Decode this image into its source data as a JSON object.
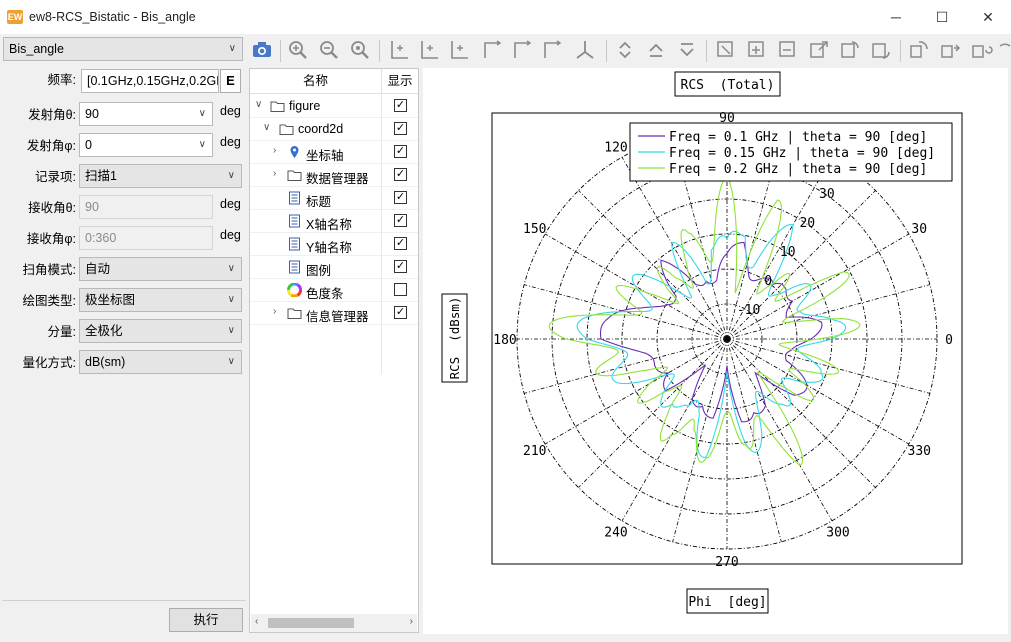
{
  "window": {
    "title": "ew8-RCS_Bistatic - Bis_angle",
    "logo_text": "EW",
    "minimize_glyph": "─",
    "maximize_glyph": "☐",
    "close_glyph": "✕"
  },
  "left_panel": {
    "view_select": "Bis_angle",
    "freq": {
      "label": "频率:",
      "value": "[0.1GHz,0.15GHz,0.2GHz]",
      "button": "E"
    },
    "tx_theta": {
      "label": "发射角θ:",
      "value": "90",
      "unit": "deg"
    },
    "tx_phi": {
      "label": "发射角φ:",
      "value": "0",
      "unit": "deg"
    },
    "record": {
      "label": "记录项:",
      "value": "扫描1"
    },
    "rx_theta": {
      "label": "接收角θ:",
      "value": "90",
      "unit": "deg"
    },
    "rx_phi": {
      "label": "接收角φ:",
      "value": "0:360",
      "unit": "deg"
    },
    "scan_mode": {
      "label": "扫角模式:",
      "value": "自动"
    },
    "plot_type": {
      "label": "绘图类型:",
      "value": "极坐标图"
    },
    "component": {
      "label": "分量:",
      "value": "全极化"
    },
    "quant": {
      "label": "量化方式:",
      "value": "dB(sm)"
    },
    "run_button": "执行"
  },
  "tree": {
    "col_name": "名称",
    "col_show": "显示",
    "rows": [
      {
        "label": "figure",
        "expander": "∨",
        "checked": true
      },
      {
        "label": "coord2d",
        "expander": "∨",
        "checked": true
      },
      {
        "label": "坐标轴",
        "expander": "›",
        "checked": true
      },
      {
        "label": "数据管理器",
        "expander": "›",
        "checked": true
      },
      {
        "label": "标题",
        "expander": "",
        "checked": true
      },
      {
        "label": "X轴名称",
        "expander": "",
        "checked": true
      },
      {
        "label": "Y轴名称",
        "expander": "",
        "checked": true
      },
      {
        "label": "图例",
        "expander": "",
        "checked": true
      },
      {
        "label": "色度条",
        "expander": "",
        "checked": false
      },
      {
        "label": "信息管理器",
        "expander": "›",
        "checked": true
      }
    ],
    "scroll_left": "‹",
    "scroll_right": "›"
  },
  "toolbar": {
    "icons": [
      "camera-icon",
      "zoom-in-icon",
      "zoom-out-icon",
      "zoom-reset-icon",
      "add-x-axis-icon",
      "add-z-axis-icon",
      "add-y-axis-icon",
      "axis-yx-icon",
      "axis-xz-icon",
      "axis-zy-icon",
      "axes-3d-icon",
      "move-up-down-icon",
      "move-up-icon",
      "move-down-icon",
      "fit-icon",
      "expand-icon",
      "collapse-icon",
      "export-icon",
      "rotate-icon",
      "rotate-alt-icon",
      "refresh-view-icon",
      "redo-view-icon",
      "reset-view-icon",
      "more-icon"
    ]
  },
  "plot": {
    "title": "RCS  (Total)",
    "ylabel": "RCS  (dBsm)",
    "xlabel": "Phi  [deg]",
    "colors": {
      "series1": "#6a2bb8",
      "series2": "#35d8e8",
      "series3": "#8fe33a"
    }
  },
  "chart_data": {
    "type": "polar",
    "title": "RCS  (Total)",
    "xlabel": "Phi  [deg]",
    "ylabel": "RCS  (dBsm)",
    "angle_ticks": [
      "0",
      "30",
      "60",
      "90",
      "120",
      "150",
      "180",
      "210",
      "240",
      "270",
      "300",
      "330"
    ],
    "radial_ticks": [
      "-10",
      "0",
      "10",
      "20",
      "30"
    ],
    "radial_range": [
      -20,
      40
    ],
    "legend_position": "top-right",
    "grid": true,
    "series": [
      {
        "name": "Freq = 0.1 GHz | theta = 90 [deg]",
        "phi": [
          0,
          10,
          20,
          30,
          40,
          50,
          60,
          70,
          80,
          90,
          100,
          110,
          120,
          130,
          140,
          150,
          160,
          170,
          180,
          190,
          200,
          210,
          220,
          230,
          240,
          250,
          260,
          270,
          280,
          290,
          300,
          310,
          320,
          330,
          340,
          350
        ],
        "rcs": [
          4,
          3,
          -2,
          6,
          2,
          -4,
          0,
          3,
          8,
          0,
          -3,
          2,
          -2,
          5,
          -1,
          4,
          6,
          10,
          16,
          8,
          2,
          -5,
          3,
          -6,
          0,
          -4,
          3,
          -8,
          4,
          -2,
          2,
          -3,
          5,
          2,
          -2,
          3
        ]
      },
      {
        "name": "Freq = 0.15 GHz | theta = 90 [deg]",
        "phi": [
          0,
          10,
          20,
          30,
          40,
          50,
          60,
          70,
          80,
          90,
          100,
          110,
          120,
          130,
          140,
          150,
          160,
          170,
          180,
          190,
          200,
          210,
          220,
          230,
          240,
          250,
          260,
          270,
          280,
          290,
          300,
          310,
          320,
          330,
          340,
          350
        ],
        "rcs": [
          10,
          6,
          9,
          4,
          -2,
          6,
          12,
          3,
          14,
          2,
          10,
          -2,
          6,
          2,
          4,
          7,
          10,
          14,
          20,
          14,
          8,
          4,
          6,
          -2,
          8,
          2,
          10,
          -4,
          6,
          8,
          3,
          -2,
          4,
          8,
          2,
          6
        ]
      },
      {
        "name": "Freq = 0.2 GHz | theta = 90 [deg]",
        "phi": [
          0,
          10,
          20,
          30,
          40,
          50,
          60,
          70,
          80,
          90,
          100,
          110,
          120,
          130,
          140,
          150,
          160,
          170,
          180,
          190,
          200,
          210,
          220,
          230,
          240,
          250,
          260,
          270,
          280,
          290,
          300,
          310,
          320,
          330,
          340,
          350
        ],
        "rcs": [
          6,
          12,
          2,
          14,
          4,
          -6,
          8,
          14,
          2,
          18,
          12,
          4,
          10,
          -4,
          8,
          2,
          12,
          18,
          26,
          16,
          4,
          10,
          -2,
          12,
          4,
          16,
          6,
          10,
          2,
          12,
          14,
          4,
          -4,
          10,
          6,
          2
        ]
      }
    ]
  }
}
